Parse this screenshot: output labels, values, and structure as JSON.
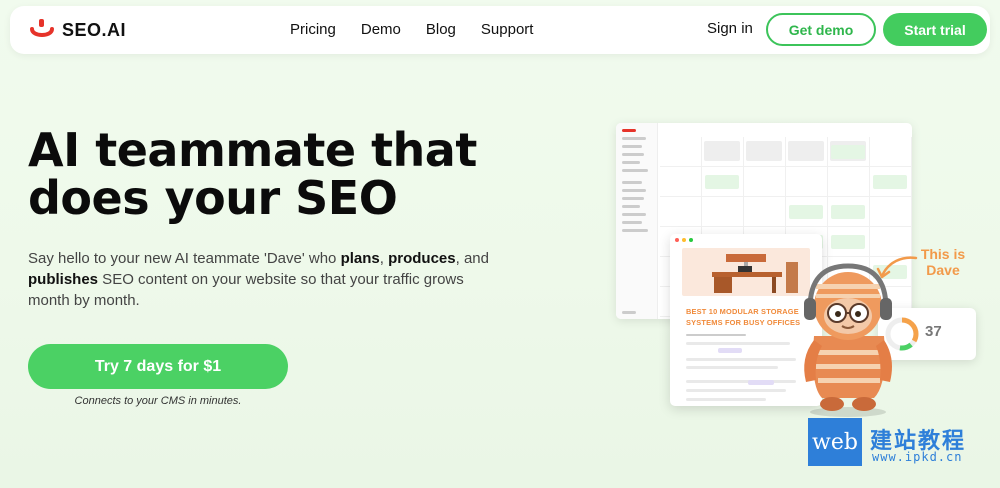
{
  "brand": {
    "name": "SEO.AI",
    "accent": "#43cc5e",
    "orange": "#f29a4a"
  },
  "nav": {
    "links": [
      "Pricing",
      "Demo",
      "Blog",
      "Support"
    ],
    "sign_in": "Sign in",
    "get_demo": "Get demo",
    "start_trial": "Start trial"
  },
  "hero": {
    "title_line1": "AI teammate that",
    "title_line2": "does your SEO",
    "sub_1": "Say hello to your new AI teammate 'Dave' who ",
    "sub_plans": "plans",
    "sub_2": ", ",
    "sub_produces": "produces",
    "sub_3": ", and ",
    "sub_publishes": "publishes",
    "sub_4": " SEO content on your website so that your traffic grows month by month.",
    "cta": "Try 7 days for $1",
    "cta_note": "Connects to your CMS in minutes."
  },
  "illustration": {
    "article_title": "BEST 10 MODULAR STORAGE SYSTEMS FOR BUSY OFFICES",
    "score": "37",
    "score_fraction": 0.37,
    "dave_label": "This is Dave"
  },
  "watermark": {
    "box": "web",
    "cn": "建站教程",
    "url": "www.ipkd.cn"
  }
}
